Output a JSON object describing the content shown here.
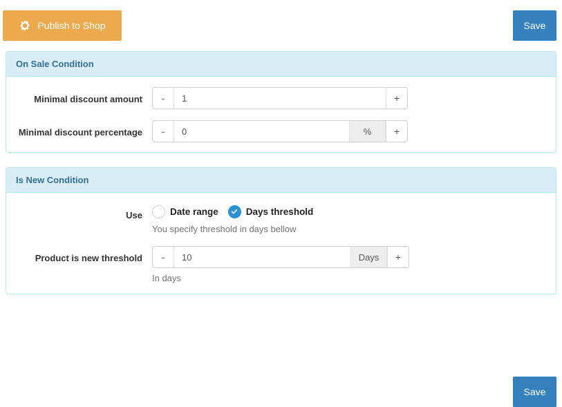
{
  "toolbar": {
    "publish_label": "Publish to Shop",
    "publish_icon": "gear-icon",
    "save_label": "Save",
    "publish_color": "#edaa4d",
    "save_color": "#3581bd"
  },
  "footer": {
    "save_label": "Save"
  },
  "panels": [
    {
      "title": "On Sale Condition",
      "rows": [
        {
          "label": "Minimal discount amount",
          "decrement": "-",
          "increment": "+",
          "value": "1",
          "addon": null,
          "help": null
        },
        {
          "label": "Minimal discount percentage",
          "decrement": "-",
          "increment": "+",
          "value": "0",
          "addon": "%",
          "help": null
        }
      ]
    },
    {
      "title": "Is New Condition",
      "use_label": "Use",
      "radios": [
        {
          "label": "Date range",
          "checked": false
        },
        {
          "label": "Days threshold",
          "checked": true
        }
      ],
      "radio_help": "You specify threshold in days bellow",
      "rows": [
        {
          "label": "Product is new threshold",
          "decrement": "-",
          "increment": "+",
          "value": "10",
          "addon": "Days",
          "help": "In days"
        }
      ]
    }
  ],
  "theme": {
    "panel_header_bg": "#d9edf7",
    "panel_border": "#bce8f1",
    "panel_title_color": "#31708f",
    "radio_checked_color": "#2a92d4",
    "help_text_color": "#737373"
  }
}
